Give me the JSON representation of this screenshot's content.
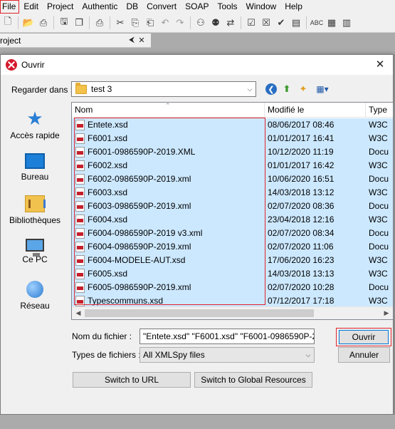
{
  "menubar": {
    "items": [
      "File",
      "Edit",
      "Project",
      "Authentic",
      "DB",
      "Convert",
      "SOAP",
      "Tools",
      "Window",
      "Help"
    ]
  },
  "toolbar": {
    "icons": [
      "new-document-icon",
      "open-folder-icon",
      "open-file-icon",
      "save-icon",
      "save-all-icon",
      "print-icon",
      "cut-icon",
      "copy-icon",
      "paste-icon",
      "undo-icon",
      "redo-icon",
      "find-icon",
      "find-next-icon",
      "replace-icon",
      "validate-icon",
      "check-wellformed-icon",
      "check-icon",
      "schema-icon",
      "spelling-icon",
      "grid-icon",
      "text-icon"
    ]
  },
  "project_panel": {
    "title": "roject",
    "pin": "⮜",
    "close": "✕"
  },
  "dialog": {
    "title": "Ouvrir",
    "look_in_label": "Regarder dans :",
    "look_in_value": "test 3",
    "places": [
      {
        "label": "Accès rapide"
      },
      {
        "label": "Bureau"
      },
      {
        "label": "Bibliothèques"
      },
      {
        "label": "Ce PC"
      },
      {
        "label": "Réseau"
      }
    ],
    "columns": {
      "name": "Nom",
      "date": "Modifié le",
      "type": "Type"
    },
    "files": [
      {
        "name": "Entete.xsd",
        "date": "08/06/2017 08:46",
        "type": "W3C"
      },
      {
        "name": "F6001.xsd",
        "date": "01/01/2017 16:41",
        "type": "W3C"
      },
      {
        "name": "F6001-0986590P-2019.XML",
        "date": "10/12/2020 11:19",
        "type": "Docu"
      },
      {
        "name": "F6002.xsd",
        "date": "01/01/2017 16:42",
        "type": "W3C"
      },
      {
        "name": "F6002-0986590P-2019.xml",
        "date": "10/06/2020 16:51",
        "type": "Docu"
      },
      {
        "name": "F6003.xsd",
        "date": "14/03/2018 13:12",
        "type": "W3C"
      },
      {
        "name": "F6003-0986590P-2019.xml",
        "date": "02/07/2020 08:36",
        "type": "Docu"
      },
      {
        "name": "F6004.xsd",
        "date": "23/04/2018 12:16",
        "type": "W3C"
      },
      {
        "name": "F6004-0986590P-2019 v3.xml",
        "date": "02/07/2020 08:34",
        "type": "Docu"
      },
      {
        "name": "F6004-0986590P-2019.xml",
        "date": "02/07/2020 11:06",
        "type": "Docu"
      },
      {
        "name": "F6004-MODELE-AUT.xsd",
        "date": "17/06/2020 16:23",
        "type": "W3C"
      },
      {
        "name": "F6005.xsd",
        "date": "14/03/2018 13:13",
        "type": "W3C"
      },
      {
        "name": "F6005-0986590P-2019.xml",
        "date": "02/07/2020 10:28",
        "type": "Docu"
      },
      {
        "name": "Typescommuns.xsd",
        "date": "07/12/2017 17:18",
        "type": "W3C"
      }
    ],
    "filename_label": "Nom du fichier :",
    "filename_value": "\"Entete.xsd\" \"F6001.xsd\" \"F6001-0986590P-2(",
    "filetype_label": "Types de fichiers :",
    "filetype_value": "All XMLSpy files",
    "open_button": "Ouvrir",
    "cancel_button": "Annuler",
    "switch_url_button": "Switch to URL",
    "switch_global_button": "Switch to Global Resources"
  },
  "colors": {
    "selection": "#cce8ff",
    "highlight_outline": "#e0232c",
    "focus_border": "#0078d7"
  }
}
